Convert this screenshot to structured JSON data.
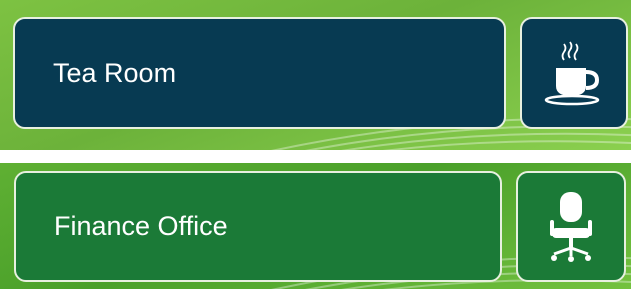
{
  "rooms": [
    {
      "name": "Tea Room",
      "icon": "coffee-cup-icon",
      "box_color": "#073a52",
      "background_color": "#7dc242"
    },
    {
      "name": "Finance Office",
      "icon": "office-chair-icon",
      "box_color": "#1b7a37",
      "background_color": "#5fb033"
    }
  ]
}
